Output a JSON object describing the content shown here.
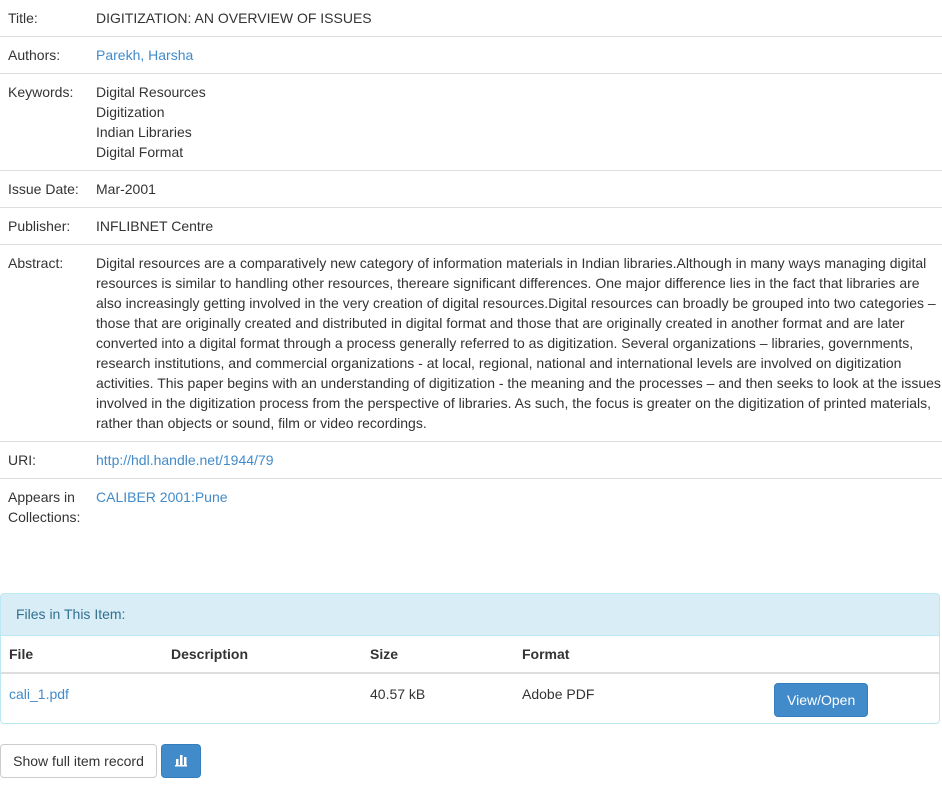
{
  "metadata": {
    "title_label": "Title:",
    "title_value": "DIGITIZATION: AN OVERVIEW OF ISSUES",
    "authors_label": "Authors:",
    "authors_value": "Parekh, Harsha",
    "keywords_label": "Keywords:",
    "keywords": [
      "Digital Resources",
      "Digitization",
      "Indian Libraries",
      "Digital Format"
    ],
    "issue_date_label": "Issue Date:",
    "issue_date_value": "Mar-2001",
    "publisher_label": "Publisher:",
    "publisher_value": "INFLIBNET Centre",
    "abstract_label": "Abstract:",
    "abstract_value": "Digital resources are a comparatively new category of information materials in Indian libraries.Although in many ways managing digital resources is similar to handling other resources, thereare significant differences. One major difference lies in the fact that libraries are also increasingly getting involved in the very creation of digital resources.Digital resources can broadly be grouped into two categories – those that are originally created and distributed in digital format and those that are originally created in another format and are later converted into a digital format through a process generally referred to as digitization. Several organizations – libraries, governments, research institutions, and commercial organizations - at local, regional, national and international levels are involved on digitization activities. This paper begins with an understanding of digitization - the meaning and the processes – and then seeks to look at the issues involved in the digitization process from the perspective of libraries. As such, the focus is greater on the digitization of printed materials, rather than objects or sound, film or video recordings.",
    "uri_label": "URI:",
    "uri_value": "http://hdl.handle.net/1944/79",
    "collections_label": "Appears in Collections:",
    "collections_value": "CALIBER 2001:Pune"
  },
  "files": {
    "heading": "Files in This Item:",
    "columns": [
      "File",
      "Description",
      "Size",
      "Format",
      ""
    ],
    "rows": [
      {
        "file": "cali_1.pdf",
        "description": "",
        "size": "40.57 kB",
        "format": "Adobe PDF",
        "action": "View/Open"
      }
    ]
  },
  "buttons": {
    "show_full_record": "Show full item record",
    "stats_icon": "bar-chart-icon"
  },
  "colors": {
    "link": "#428bca",
    "primary_button": "#428bca",
    "panel_heading_bg": "#d9edf7",
    "panel_heading_text": "#31708f"
  }
}
